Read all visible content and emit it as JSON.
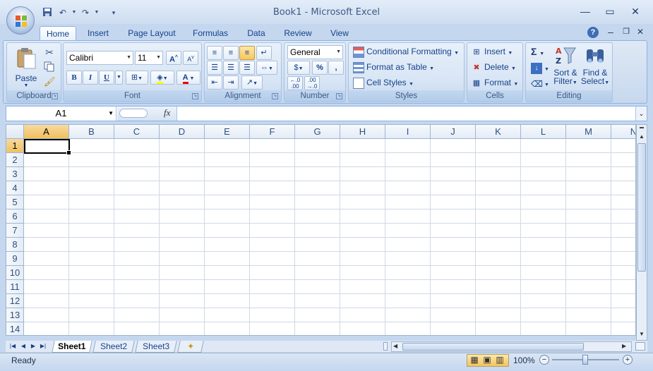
{
  "window": {
    "title": "Book1 - Microsoft Excel"
  },
  "ribbon_tabs": [
    "Home",
    "Insert",
    "Page Layout",
    "Formulas",
    "Data",
    "Review",
    "View"
  ],
  "clipboard": {
    "paste": "Paste",
    "label": "Clipboard"
  },
  "font": {
    "name": "Calibri",
    "size": "11",
    "bold": "B",
    "italic": "I",
    "underline": "U",
    "grow": "A",
    "shrink": "A",
    "color_letter": "A",
    "label": "Font"
  },
  "alignment": {
    "label": "Alignment"
  },
  "number": {
    "format": "General",
    "percent": "%",
    "comma": ",",
    "label": "Number"
  },
  "styles": {
    "conditional": "Conditional Formatting",
    "format_table": "Format as Table",
    "cell_styles": "Cell Styles",
    "label": "Styles"
  },
  "cells": {
    "insert": "Insert",
    "delete": "Delete",
    "format": "Format",
    "label": "Cells"
  },
  "editing": {
    "sum": "Σ",
    "sort_line1": "Sort &",
    "sort_line2": "Filter",
    "find_line1": "Find &",
    "find_line2": "Select",
    "label": "Editing"
  },
  "formula_bar": {
    "name_box": "A1",
    "fx": "fx",
    "value": ""
  },
  "grid": {
    "columns": [
      "A",
      "B",
      "C",
      "D",
      "E",
      "F",
      "G",
      "H",
      "I",
      "J",
      "K",
      "L",
      "M",
      "N"
    ],
    "rows": [
      "1",
      "2",
      "3",
      "4",
      "5",
      "6",
      "7",
      "8",
      "9",
      "10",
      "11",
      "12",
      "13",
      "14"
    ],
    "active_cell": "A1"
  },
  "sheets": [
    "Sheet1",
    "Sheet2",
    "Sheet3"
  ],
  "active_sheet": "Sheet1",
  "status": {
    "text": "Ready",
    "zoom": "100%"
  },
  "colors": {
    "accent": "#15428b",
    "ribbon": "#dfe9f5",
    "selected_header": "#f1c15f"
  }
}
